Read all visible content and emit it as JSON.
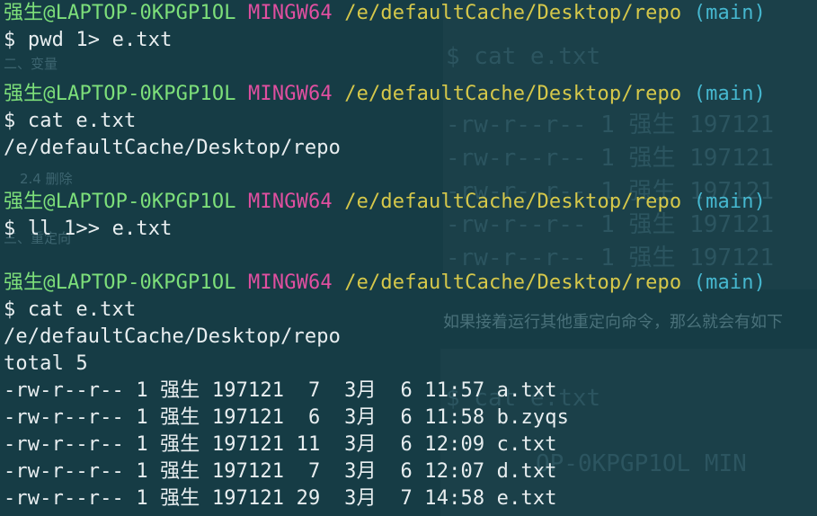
{
  "prompt": {
    "user_host": "强生@LAPTOP-0KPGP1OL",
    "env": "MINGW64",
    "cwd": "/e/defaultCache/Desktop/repo",
    "branch": "(main)",
    "symbol": "$"
  },
  "commands": [
    "pwd 1> e.txt",
    "cat e.txt",
    "ll 1>> e.txt",
    "cat e.txt"
  ],
  "outputs": {
    "cat1": "/e/defaultCache/Desktop/repo",
    "cat2_first": "/e/defaultCache/Desktop/repo",
    "total": "total 5"
  },
  "listing": [
    "-rw-r--r-- 1 强生 197121  7  3月  6 11:57 a.txt",
    "-rw-r--r-- 1 强生 197121  6  3月  6 11:58 b.zyqs",
    "-rw-r--r-- 1 强生 197121 11  3月  6 12:09 c.txt",
    "-rw-r--r-- 1 强生 197121  7  3月  6 12:07 d.txt",
    "-rw-r--r-- 1 强生 197121 29  3月  7 14:58 e.txt"
  ],
  "background": {
    "heading_1": "二、变量",
    "heading_2": "2.4 删除",
    "heading_3": "三、重定向",
    "prose": "如果接着运行其他重定向命令，那么就会有如下",
    "code_1": "$ cat e.txt",
    "code_rows": [
      "-rw-r--r-- 1 强生 197121",
      "-rw-r--r-- 1 强生 197121",
      "-rw-r--r-- 1 强生 197121",
      "-rw-r--r-- 1 强生 197121",
      "-rw-r--r-- 1 强生 197121"
    ],
    "code_2": "$ cat e.txt",
    "code_3": "OP-0KPGP1OL MIN"
  },
  "colors": {
    "user": "#7ddf7a",
    "env": "#e04fa0",
    "path": "#d6c84a",
    "branch": "#46b8d0",
    "text": "#e8eef0",
    "background": "#0f2f38"
  }
}
